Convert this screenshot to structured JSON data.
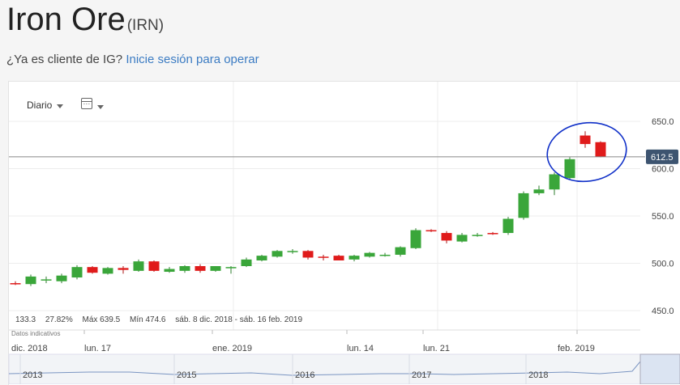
{
  "header": {
    "title": "Iron Ore",
    "code": "(IRN)",
    "login_prompt": "¿Ya es cliente de IG?",
    "login_link": "Inicie sesión para operar"
  },
  "toolbar": {
    "interval": "Diario",
    "calendar_icon": "calendar-icon"
  },
  "stats": {
    "change": "133.3",
    "change_pct": "27.82%",
    "max": "Máx 639.5",
    "min": "Mín 474.6",
    "range": "sáb. 8 dic. 2018 - sáb. 16 feb. 2019",
    "note": "Datos indicativos"
  },
  "colors": {
    "up": "#3aa63a",
    "down": "#e01b1b",
    "price_tag": "#3d5470",
    "annotation": "#1030c8"
  },
  "chart_data": {
    "type": "candlestick",
    "current_price": "612.5",
    "y_ticks": [
      "650.0",
      "600.0",
      "550.0",
      "500.0",
      "450.0"
    ],
    "ylim": [
      440,
      662
    ],
    "x_labels": [
      "dic. 2018",
      "lun. 17",
      "ene. 2019",
      "lun. 14",
      "lun. 21",
      "feb. 2019"
    ],
    "navigator_labels": [
      "2013",
      "2015",
      "2016",
      "2017",
      "2018"
    ],
    "candles": [
      {
        "o": 479,
        "h": 481,
        "l": 477,
        "c": 478
      },
      {
        "o": 478,
        "h": 488,
        "l": 476,
        "c": 486
      },
      {
        "o": 482,
        "h": 486,
        "l": 479,
        "c": 483
      },
      {
        "o": 481,
        "h": 489,
        "l": 479,
        "c": 487
      },
      {
        "o": 485,
        "h": 498,
        "l": 483,
        "c": 496
      },
      {
        "o": 496,
        "h": 497,
        "l": 489,
        "c": 490
      },
      {
        "o": 489,
        "h": 496,
        "l": 488,
        "c": 495
      },
      {
        "o": 495,
        "h": 497,
        "l": 489,
        "c": 493
      },
      {
        "o": 492,
        "h": 504,
        "l": 491,
        "c": 502
      },
      {
        "o": 502,
        "h": 503,
        "l": 491,
        "c": 492
      },
      {
        "o": 491,
        "h": 496,
        "l": 490,
        "c": 494
      },
      {
        "o": 492,
        "h": 498,
        "l": 490,
        "c": 497
      },
      {
        "o": 497,
        "h": 499,
        "l": 490,
        "c": 492
      },
      {
        "o": 492,
        "h": 497,
        "l": 491,
        "c": 497
      },
      {
        "o": 496,
        "h": 497,
        "l": 489,
        "c": 496
      },
      {
        "o": 497,
        "h": 506,
        "l": 496,
        "c": 504
      },
      {
        "o": 503,
        "h": 509,
        "l": 502,
        "c": 508
      },
      {
        "o": 507,
        "h": 514,
        "l": 506,
        "c": 513
      },
      {
        "o": 512,
        "h": 515,
        "l": 510,
        "c": 513
      },
      {
        "o": 513,
        "h": 514,
        "l": 504,
        "c": 506
      },
      {
        "o": 507,
        "h": 509,
        "l": 503,
        "c": 506
      },
      {
        "o": 508,
        "h": 509,
        "l": 503,
        "c": 503
      },
      {
        "o": 504,
        "h": 509,
        "l": 502,
        "c": 508
      },
      {
        "o": 507,
        "h": 512,
        "l": 506,
        "c": 511
      },
      {
        "o": 509,
        "h": 511,
        "l": 507,
        "c": 509
      },
      {
        "o": 509,
        "h": 518,
        "l": 507,
        "c": 517
      },
      {
        "o": 516,
        "h": 537,
        "l": 515,
        "c": 535
      },
      {
        "o": 535,
        "h": 536,
        "l": 533,
        "c": 534
      },
      {
        "o": 532,
        "h": 534,
        "l": 521,
        "c": 524
      },
      {
        "o": 523,
        "h": 532,
        "l": 522,
        "c": 530
      },
      {
        "o": 530,
        "h": 532,
        "l": 528,
        "c": 530
      },
      {
        "o": 532,
        "h": 533,
        "l": 530,
        "c": 531
      },
      {
        "o": 532,
        "h": 549,
        "l": 530,
        "c": 547
      },
      {
        "o": 548,
        "h": 576,
        "l": 546,
        "c": 574
      },
      {
        "o": 574,
        "h": 582,
        "l": 572,
        "c": 578
      },
      {
        "o": 578,
        "h": 596,
        "l": 572,
        "c": 594
      },
      {
        "o": 590,
        "h": 612,
        "l": 589,
        "c": 610
      },
      {
        "o": 635,
        "h": 639.5,
        "l": 622,
        "c": 626
      },
      {
        "o": 628,
        "h": 629,
        "l": 612,
        "c": 612.5
      }
    ]
  }
}
